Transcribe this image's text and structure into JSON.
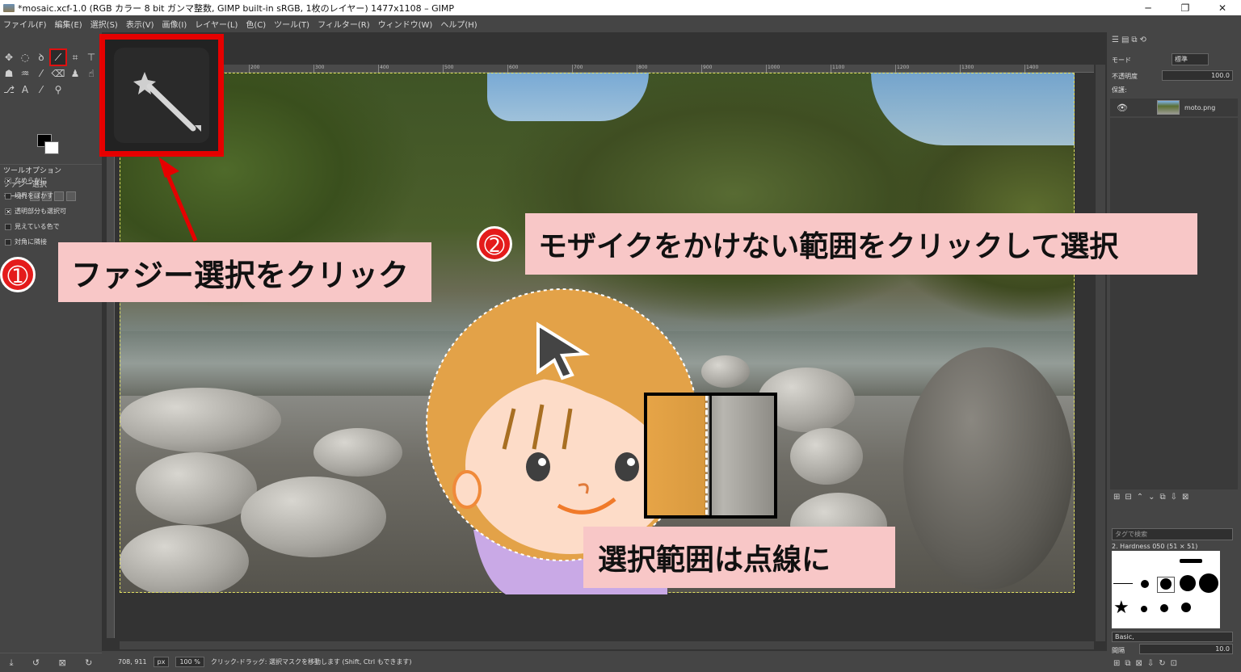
{
  "window": {
    "title": "*mosaic.xcf-1.0 (RGB カラー 8 bit ガンマ整数, GIMP built-in sRGB, 1枚のレイヤー) 1477x1108 – GIMP",
    "minimize": "─",
    "maximize": "❐",
    "close": "✕"
  },
  "menu": [
    "ファイル(F)",
    "編集(E)",
    "選択(S)",
    "表示(V)",
    "画像(I)",
    "レイヤー(L)",
    "色(C)",
    "ツール(T)",
    "フィルター(R)",
    "ウィンドウ(W)",
    "ヘルプ(H)"
  ],
  "toolbox": {
    "tool_options_tab": "ツールオプション",
    "tool_title": "ファジー選択",
    "mode_label": "モード:",
    "options": [
      {
        "label": "なめらかに",
        "checked": true
      },
      {
        "label": "境界をぼかす",
        "checked": false
      },
      {
        "label": "透明部分も選択可",
        "checked": true
      },
      {
        "label": "見えている色で",
        "checked": false
      },
      {
        "label": "対角に隣接",
        "checked": false
      }
    ]
  },
  "ruler": {
    "h_ticks": [
      "200",
      "300",
      "400",
      "500",
      "600",
      "700",
      "800",
      "900",
      "1000",
      "1100",
      "1200",
      "1300",
      "1400"
    ]
  },
  "status": {
    "coords": "708, 911",
    "unit": "px",
    "zoom": "100 %",
    "message": "クリック-ドラッグ: 選択マスクを移動します (Shift, Ctrl もできます)"
  },
  "layers": {
    "mode_label": "モード",
    "mode_value": "標準",
    "opacity_label": "不透明度",
    "opacity_value": "100.0",
    "lock_label": "保護:",
    "layer_name": "moto.png"
  },
  "brushes": {
    "tag_placeholder": "タグで検索",
    "brush_name": "2. Hardness 050 (51 × 51)",
    "preset": "Basic,",
    "spacing_label": "間隔",
    "spacing_value": "10.0"
  },
  "annotations": {
    "step1_number": "➀",
    "step1_text": "ファジー選択をクリック",
    "step2_number": "➁",
    "step2_text": "モザイクをかけない範囲をクリックして選択",
    "note_text": "選択範囲は点線に"
  },
  "colors": {
    "accent_red": "#e60000",
    "callout_pink": "#f8c7c7"
  }
}
